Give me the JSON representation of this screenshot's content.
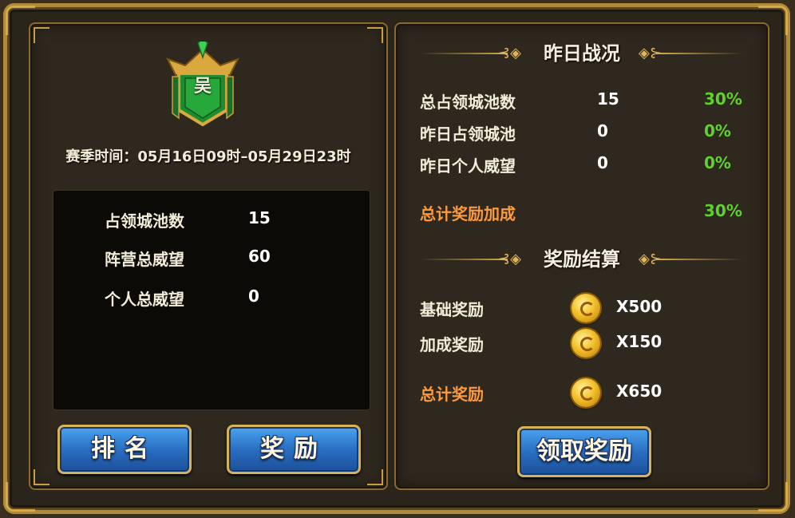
{
  "left": {
    "emblem_letter": "吴",
    "season_time": "赛季时间：05月16日09时–05月29日23时",
    "stats": [
      {
        "label": "占领城池数",
        "value": "15"
      },
      {
        "label": "阵营总威望",
        "value": "60"
      },
      {
        "label": "个人总威望",
        "value": "0"
      }
    ],
    "rank_button": "排名",
    "reward_button": "奖励"
  },
  "right": {
    "yesterday_title": "昨日战况",
    "rows": [
      {
        "label": "总占领城池数",
        "value": "15",
        "percent": "30%"
      },
      {
        "label": "昨日占领城池",
        "value": "0",
        "percent": "0%"
      },
      {
        "label": "昨日个人威望",
        "value": "0",
        "percent": "0%"
      }
    ],
    "total_bonus_label": "总计奖励加成",
    "total_bonus_percent": "30%",
    "settlement_title": "奖励结算",
    "rewards": [
      {
        "label": "基础奖励",
        "amount": "X500",
        "icon": "gold-coin-icon"
      },
      {
        "label": "加成奖励",
        "amount": "X150",
        "icon": "gold-coin-icon"
      }
    ],
    "total_reward_label": "总计奖励",
    "total_reward_amount": "X650",
    "claim_button": "领取奖励"
  },
  "colors": {
    "gold_frame": "#b08a3a",
    "button_blue": "#2a6fc2",
    "percent_green": "#5fd12e",
    "total_orange": "#ff9a3c"
  }
}
